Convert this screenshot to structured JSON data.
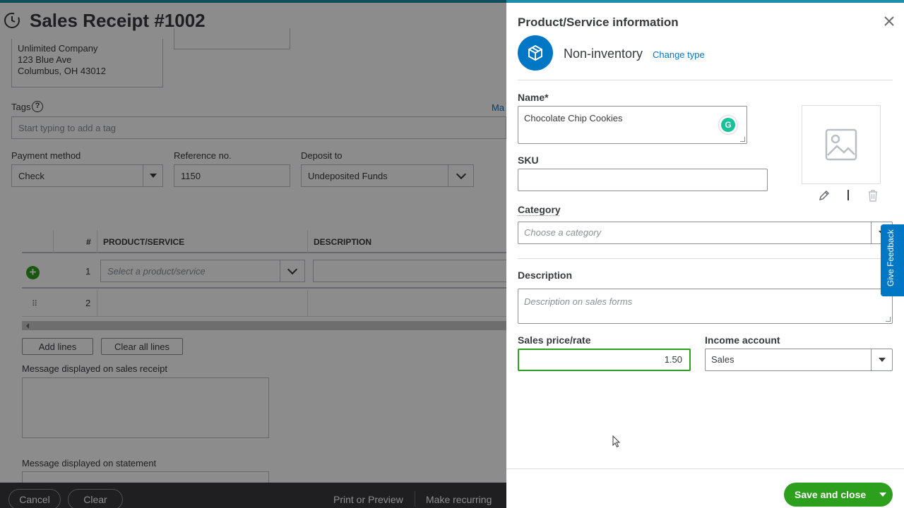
{
  "page": {
    "title": "Sales Receipt #1002",
    "billing_address": [
      "Unlimited Company",
      "123 Blue Ave",
      "Columbus, OH  43012"
    ],
    "tags": {
      "label": "Tags",
      "placeholder": "Start typing to add a tag",
      "manage_link": "Ma"
    },
    "payment_method": {
      "label": "Payment method",
      "value": "Check"
    },
    "reference_no": {
      "label": "Reference no.",
      "value": "1150"
    },
    "deposit_to": {
      "label": "Deposit to",
      "value": "Undeposited Funds"
    },
    "table": {
      "columns": [
        "#",
        "PRODUCT/SERVICE",
        "DESCRIPTION"
      ],
      "rows": [
        {
          "num": "1",
          "product_placeholder": "Select a product/service"
        },
        {
          "num": "2"
        }
      ]
    },
    "add_lines": "Add lines",
    "clear_all_lines": "Clear all lines",
    "message_receipt_label": "Message displayed on sales receipt",
    "message_statement_label": "Message displayed on statement",
    "footer": {
      "cancel": "Cancel",
      "clear": "Clear",
      "print_preview": "Print or Preview",
      "make_recurring": "Make recurring"
    }
  },
  "drawer": {
    "title": "Product/Service information",
    "type_label": "Non-inventory",
    "change_type": "Change type",
    "name": {
      "label": "Name*",
      "value": "Chocolate Chip Cookies"
    },
    "sku": {
      "label": "SKU",
      "value": ""
    },
    "category": {
      "label": "Category",
      "placeholder": "Choose a category"
    },
    "description": {
      "label": "Description",
      "placeholder": "Description on sales forms"
    },
    "sales_price": {
      "label": "Sales price/rate",
      "value": "1.50"
    },
    "income_account": {
      "label": "Income account",
      "value": "Sales"
    },
    "feedback": "Give Feedback",
    "save_and_close": "Save and close"
  },
  "colors": {
    "accent": "#0077c5",
    "primary": "#2ca01c",
    "text": "#393a3d",
    "footer": "#393a3d"
  }
}
